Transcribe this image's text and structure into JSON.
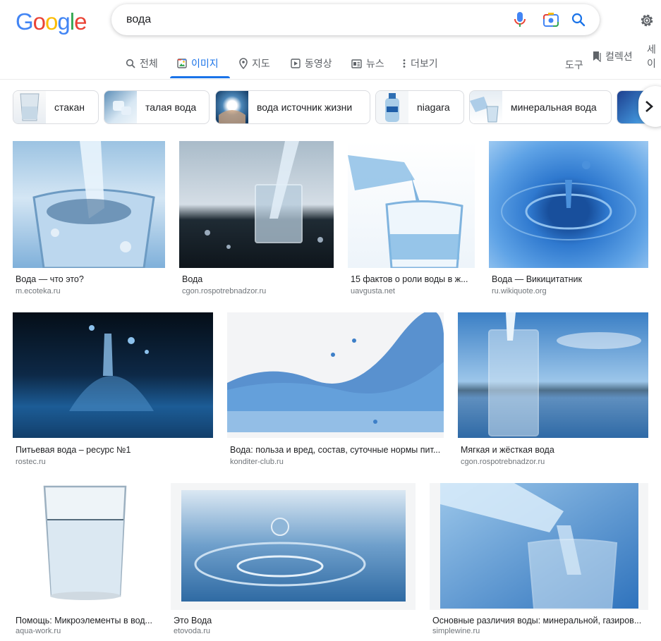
{
  "search": {
    "query": "вода"
  },
  "logo": {
    "letters": [
      "G",
      "o",
      "o",
      "g",
      "l",
      "e"
    ],
    "colors": [
      "#4285f4",
      "#ea4335",
      "#fbbc05",
      "#4285f4",
      "#34a853",
      "#ea4335"
    ]
  },
  "tabs": [
    {
      "label": "전체",
      "icon": "search-icon"
    },
    {
      "label": "이미지",
      "icon": "image-icon",
      "active": true
    },
    {
      "label": "지도",
      "icon": "map-pin-icon"
    },
    {
      "label": "동영상",
      "icon": "play-icon"
    },
    {
      "label": "뉴스",
      "icon": "news-icon"
    },
    {
      "label": "더보기",
      "icon": "more-vert-icon"
    }
  ],
  "tools": {
    "label": "도구",
    "collections": "컬렉션",
    "safe": "세이"
  },
  "chips": [
    {
      "label": "стакан"
    },
    {
      "label": "талая вода"
    },
    {
      "label": "вода источник жизни"
    },
    {
      "label": "niagara"
    },
    {
      "label": "минеральная вода"
    }
  ],
  "results": [
    {
      "title": "Вода — что это?",
      "source": "m.ecoteka.ru"
    },
    {
      "title": "Вода",
      "source": "cgon.rospotrebnadzor.ru"
    },
    {
      "title": "15 фактов о роли воды в ж...",
      "source": "uavgusta.net"
    },
    {
      "title": "Вода — Викицитатник",
      "source": "ru.wikiquote.org"
    },
    {
      "title": "Питьевая вода – ресурс №1",
      "source": "rostec.ru"
    },
    {
      "title": "Вода: польза и вред, состав, суточные нормы пит...",
      "source": "konditer-club.ru"
    },
    {
      "title": "Мягкая и жёсткая вода",
      "source": "cgon.rospotrebnadzor.ru"
    },
    {
      "title": "Помощь: Микроэлементы в вод...",
      "source": "aqua-work.ru"
    },
    {
      "title": "Это Вода",
      "source": "etovoda.ru"
    },
    {
      "title": "Основные различия воды: минеральной, газиров...",
      "source": "simplewine.ru"
    }
  ]
}
